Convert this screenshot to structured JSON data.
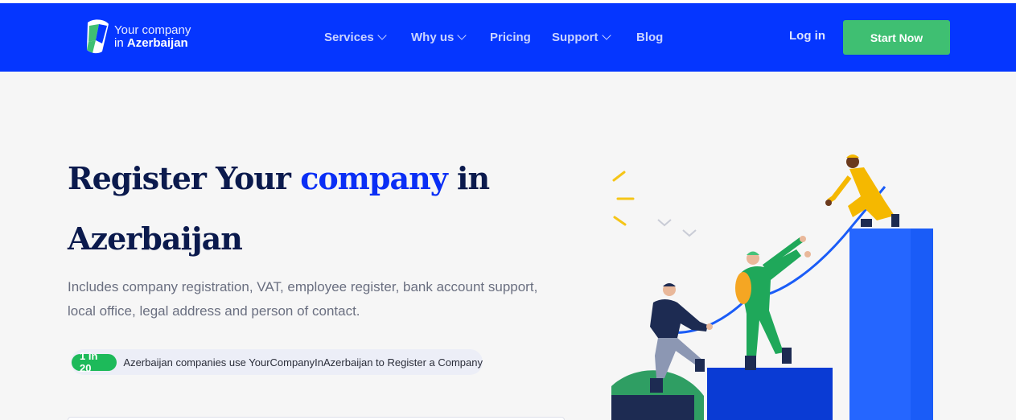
{
  "brand": {
    "line1": "Your company",
    "line2_prefix": "in",
    "line2_bold": "Azerbaijan"
  },
  "nav": {
    "items": [
      {
        "label": "Services",
        "has_dropdown": true
      },
      {
        "label": "Why us",
        "has_dropdown": true
      },
      {
        "label": "Pricing",
        "has_dropdown": false
      },
      {
        "label": "Support",
        "has_dropdown": true
      },
      {
        "label": "Blog",
        "has_dropdown": false
      }
    ],
    "login": "Log in",
    "cta": "Start Now"
  },
  "hero": {
    "headline_part1": "Register Your",
    "headline_accent": "company",
    "headline_part2": "in",
    "headline_part3": "Azerbaijan",
    "subtitle": "Includes company registration, VAT, employee register, bank account support, local office, legal address and person of contact.",
    "stat_badge": "1 in 20",
    "stat_text": "Azerbaijan companies use YourCompanyInAzerbaijan to Register a Company"
  },
  "colors": {
    "nav_bg": "#0536ff",
    "cta_bg": "#3fbf72",
    "accent": "#0a2ef5",
    "headline": "#0b1a4d",
    "badge": "#1dba5a"
  }
}
